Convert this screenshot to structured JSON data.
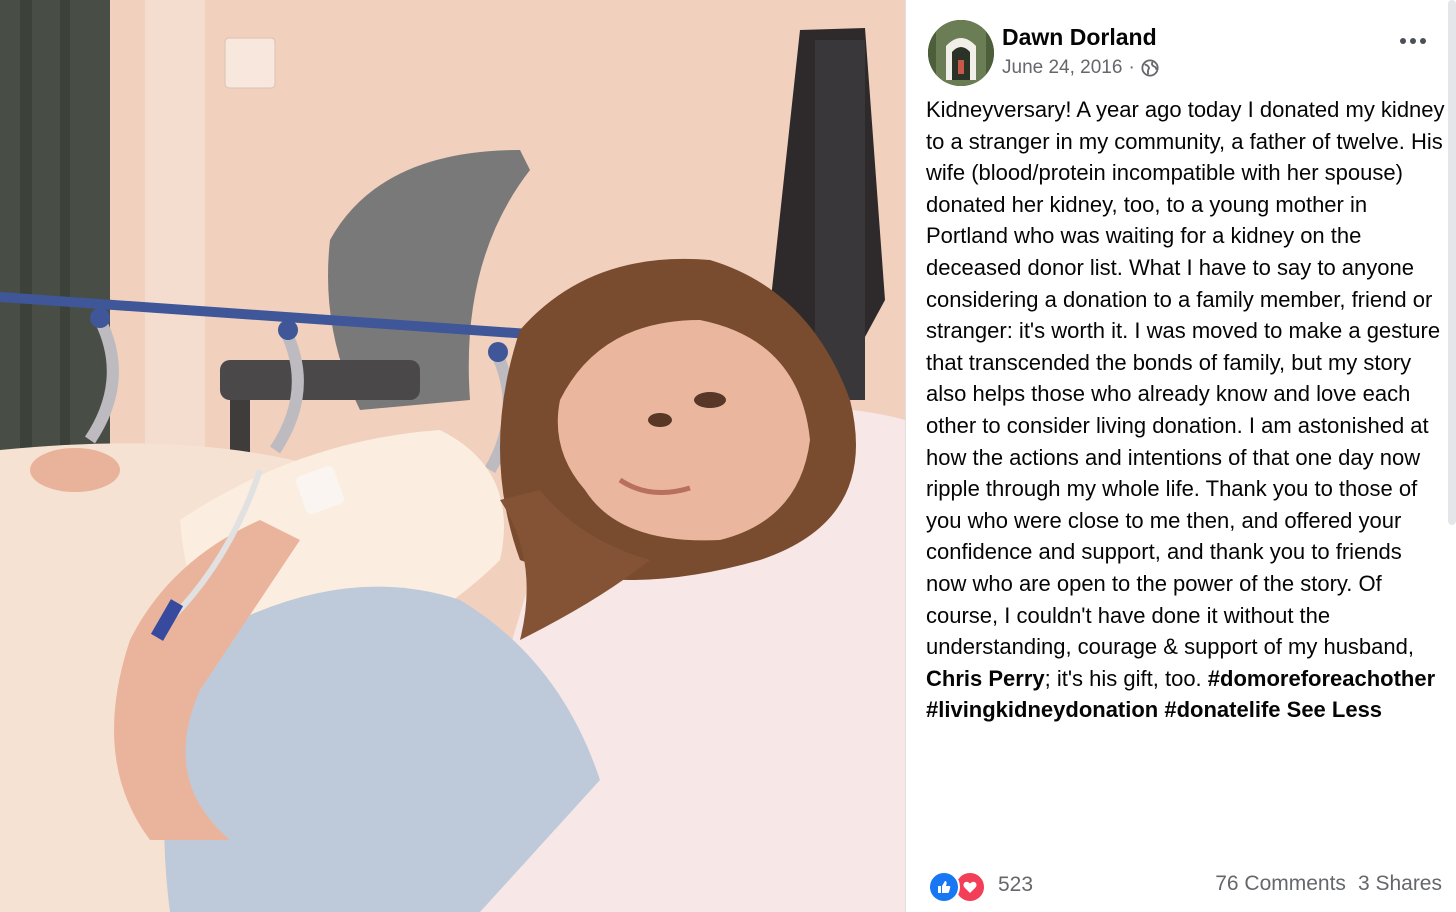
{
  "post": {
    "author": "Dawn Dorland",
    "date": "June 24, 2016",
    "date_separator": "·",
    "privacy_icon": "globe-icon",
    "more_icon": "more-options-icon",
    "text_intro": "Kidneyversary! A year ago today I donated my kidney to a stranger in my community, a father of twelve. His wife (blood/protein incompatible with her spouse) donated her kidney, too, to a young mother in Portland who was waiting for a kidney on the deceased donor list. What I have to say to anyone considering a donation to a family member, friend or stranger: it's worth it. I was moved to make a gesture that transcended the bonds of family, but my story also helps those who already know and love each other to consider living donation. I am astonished at how the actions and intentions of that one day now ripple through my whole life. Thank you to those of you who were close to me then, and offered your confidence and support, and thank you to friends now who are open to the power of the story. Of course, I couldn't have done it without the understanding, courage & support of my husband, ",
    "mention": "Chris Perry",
    "text_after_mention": "; it's his gift, too. ",
    "hashtags": [
      "#domoreforeachother",
      "#livingkidneydonation",
      "#donatelife"
    ],
    "see_less": "See Less"
  },
  "engagement": {
    "reaction_icons": [
      "like-icon",
      "love-icon"
    ],
    "reaction_count": "523",
    "comments": "76 Comments",
    "shares": "3 Shares"
  },
  "colors": {
    "like_blue": "#1877f2",
    "love_red": "#f33e58",
    "meta_gray": "#65676b"
  }
}
